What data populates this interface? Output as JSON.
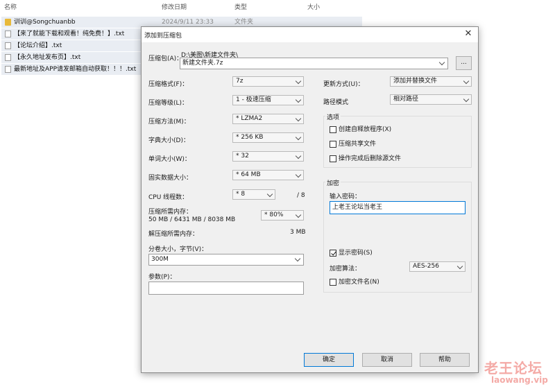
{
  "explorer": {
    "columns": {
      "name": "名称",
      "modified": "修改日期",
      "type": "类型",
      "size": "大小"
    },
    "files": [
      {
        "name": "训训@Songchuanbb",
        "date": "2024/9/11 23:33",
        "type": "文件夹",
        "icon": "folder-icon"
      },
      {
        "name": "【来了就能下载和观看！纯免费！】.txt",
        "date": "",
        "type": "",
        "icon": "text-file-icon"
      },
      {
        "name": "【论坛介绍】.txt",
        "date": "",
        "type": "",
        "icon": "text-file-icon"
      },
      {
        "name": "【永久地址发布页】.txt",
        "date": "",
        "type": "",
        "icon": "text-file-icon"
      },
      {
        "name": "最新地址及APP请发邮箱自动获取！！！.txt",
        "date": "",
        "type": "",
        "icon": "text-file-icon"
      }
    ]
  },
  "dialog": {
    "title": "添加到压缩包",
    "archive": {
      "label": "压缩包(A)：",
      "path": "D:\\美图\\新建文件夹\\",
      "value": "新建文件夹.7z",
      "browse": "..."
    },
    "format": {
      "label": "压缩格式(F)：",
      "value": "7z"
    },
    "level": {
      "label": "压缩等级(L)：",
      "value": "1 - 极速压缩"
    },
    "method": {
      "label": "压缩方法(M)：",
      "value": "* LZMA2"
    },
    "dict": {
      "label": "字典大小(D)：",
      "value": "* 256 KB"
    },
    "word": {
      "label": "单词大小(W)：",
      "value": "* 32"
    },
    "solid": {
      "label": "固实数据大小：",
      "value": "* 64 MB"
    },
    "cpu": {
      "label": "CPU 线程数：",
      "value": "* 8",
      "max": "/ 8"
    },
    "mem_compress": {
      "label": "压缩所需内存：",
      "detail": "50 MB / 6431 MB / 8038 MB",
      "value": "* 80%"
    },
    "mem_decompress": {
      "label": "解压缩所需内存：",
      "value": "3 MB"
    },
    "split": {
      "label": "分卷大小，字节(V)：",
      "value": "300M"
    },
    "params": {
      "label": "参数(P)：",
      "value": ""
    },
    "update": {
      "label": "更新方式(U)：",
      "value": "添加并替换文件"
    },
    "pathmode": {
      "label": "路径模式",
      "value": "相对路径"
    },
    "options": {
      "title": "选项",
      "sfx": {
        "label": "创建自释放程序(X)",
        "checked": false
      },
      "shared": {
        "label": "压缩共享文件",
        "checked": false
      },
      "delete": {
        "label": "操作完成后删除源文件",
        "checked": false
      }
    },
    "encryption": {
      "title": "加密",
      "pwd_label": "输入密码：",
      "pwd_value": "上老王论坛当老王",
      "show": {
        "label": "显示密码(S)",
        "checked": true
      },
      "algo_label": "加密算法：",
      "algo_value": "AES-256",
      "encrypt_names": {
        "label": "加密文件名(N)",
        "checked": false
      }
    },
    "buttons": {
      "ok": "确定",
      "cancel": "取消",
      "help": "帮助"
    }
  },
  "watermark": {
    "text": "老王论坛",
    "url": "laowang.vip"
  }
}
